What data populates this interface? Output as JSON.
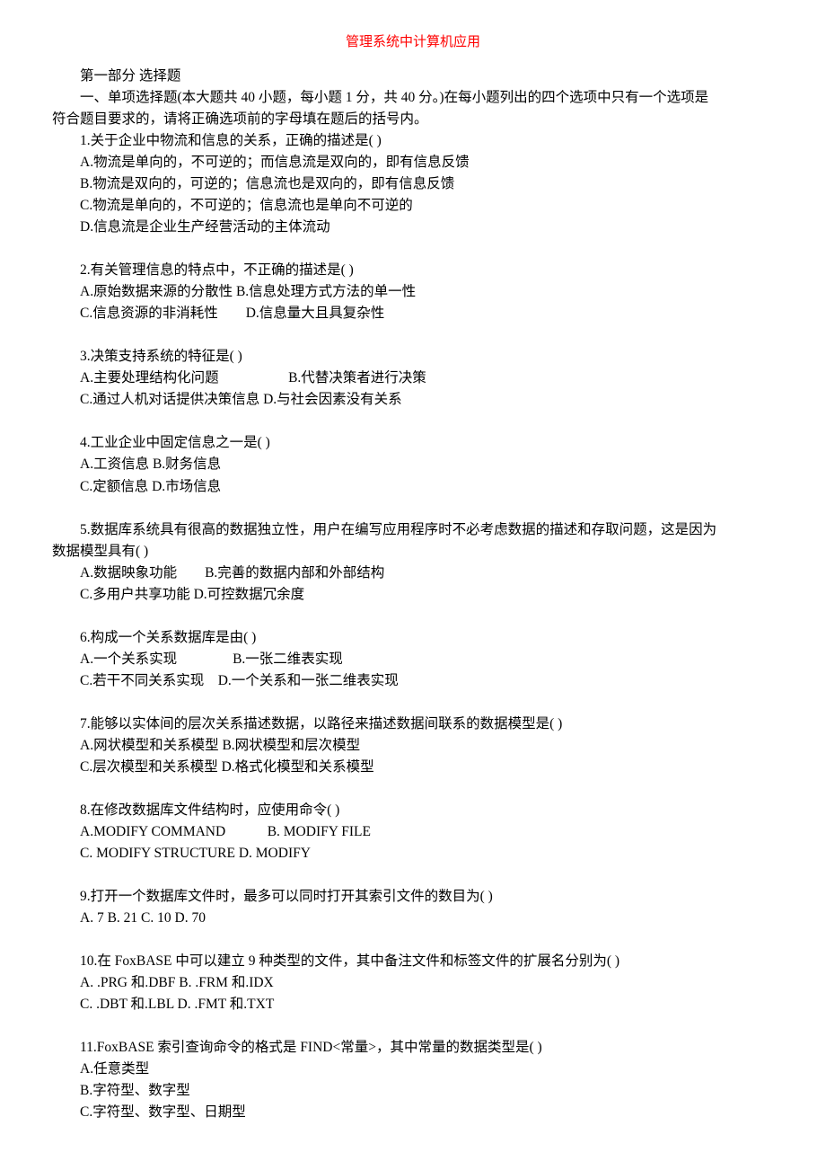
{
  "title": "管理系统中计算机应用",
  "lines": [
    {
      "cls": "para",
      "t": "第一部分 选择题"
    },
    {
      "cls": "para",
      "t": "一、单项选择题(本大题共 40 小题，每小题 1 分，共 40 分。)在每小题列出的四个选项中只有一个选项是"
    },
    {
      "cls": "no-indent",
      "t": "符合题目要求的，请将正确选项前的字母填在题后的括号内。"
    },
    {
      "cls": "para",
      "t": "1.关于企业中物流和信息的关系，正确的描述是( )"
    },
    {
      "cls": "para",
      "t": "A.物流是单向的，不可逆的；而信息流是双向的，即有信息反馈"
    },
    {
      "cls": "para",
      "t": "B.物流是双向的，可逆的；信息流也是双向的，即有信息反馈"
    },
    {
      "cls": "para",
      "t": "C.物流是单向的，不可逆的；信息流也是单向不可逆的"
    },
    {
      "cls": "para",
      "t": "D.信息流是企业生产经营活动的主体流动"
    },
    {
      "cls": "blank"
    },
    {
      "cls": "para",
      "t": "2.有关管理信息的特点中，不正确的描述是( )"
    },
    {
      "cls": "para",
      "t": "A.原始数据来源的分散性 B.信息处理方式方法的单一性"
    },
    {
      "cls": "para",
      "t": "C.信息资源的非消耗性  D.信息量大且具复杂性"
    },
    {
      "cls": "blank"
    },
    {
      "cls": "para",
      "t": "3.决策支持系统的特征是( )"
    },
    {
      "cls": "para",
      "t": "A.主要处理结构化问题     B.代替决策者进行决策"
    },
    {
      "cls": "para",
      "t": "C.通过人机对话提供决策信息 D.与社会因素没有关系"
    },
    {
      "cls": "blank"
    },
    {
      "cls": "para",
      "t": "4.工业企业中固定信息之一是( )"
    },
    {
      "cls": "para",
      "t": "A.工资信息 B.财务信息"
    },
    {
      "cls": "para",
      "t": "C.定额信息 D.市场信息"
    },
    {
      "cls": "blank"
    },
    {
      "cls": "para",
      "t": "5.数据库系统具有很高的数据独立性，用户在编写应用程序时不必考虑数据的描述和存取问题，这是因为"
    },
    {
      "cls": "no-indent",
      "t": "数据模型具有( )"
    },
    {
      "cls": "para",
      "t": "A.数据映象功能  B.完善的数据内部和外部结构"
    },
    {
      "cls": "para",
      "t": "C.多用户共享功能 D.可控数据冗余度"
    },
    {
      "cls": "blank"
    },
    {
      "cls": "para",
      "t": "6.构成一个关系数据库是由( )"
    },
    {
      "cls": "para",
      "t": "A.一个关系实现    B.一张二维表实现"
    },
    {
      "cls": "para",
      "t": "C.若干不同关系实现 D.一个关系和一张二维表实现"
    },
    {
      "cls": "blank"
    },
    {
      "cls": "para",
      "t": "7.能够以实体间的层次关系描述数据，以路径来描述数据间联系的数据模型是( )"
    },
    {
      "cls": "para",
      "t": "A.网状模型和关系模型 B.网状模型和层次模型"
    },
    {
      "cls": "para",
      "t": "C.层次模型和关系模型 D.格式化模型和关系模型"
    },
    {
      "cls": "blank"
    },
    {
      "cls": "para",
      "t": "8.在修改数据库文件结构时，应使用命令( )"
    },
    {
      "cls": "para",
      "t": "A.MODIFY COMMAND   B. MODIFY FILE"
    },
    {
      "cls": "para",
      "t": "C. MODIFY STRUCTURE D. MODIFY"
    },
    {
      "cls": "blank"
    },
    {
      "cls": "para",
      "t": "9.打开一个数据库文件时，最多可以同时打开其索引文件的数目为( )"
    },
    {
      "cls": "para",
      "t": "A. 7 B. 21 C. 10 D. 70"
    },
    {
      "cls": "blank"
    },
    {
      "cls": "para",
      "t": "10.在 FoxBASE 中可以建立 9 种类型的文件，其中备注文件和标签文件的扩展名分别为( )"
    },
    {
      "cls": "para",
      "t": "A. .PRG 和.DBF B. .FRM 和.IDX"
    },
    {
      "cls": "para",
      "t": "C. .DBT 和.LBL D. .FMT 和.TXT"
    },
    {
      "cls": "blank"
    },
    {
      "cls": "para",
      "t": "11.FoxBASE 索引查询命令的格式是 FIND<常量>，其中常量的数据类型是( )"
    },
    {
      "cls": "para",
      "t": "A.任意类型"
    },
    {
      "cls": "para",
      "t": "B.字符型、数字型"
    },
    {
      "cls": "para",
      "t": "C.字符型、数字型、日期型"
    }
  ]
}
